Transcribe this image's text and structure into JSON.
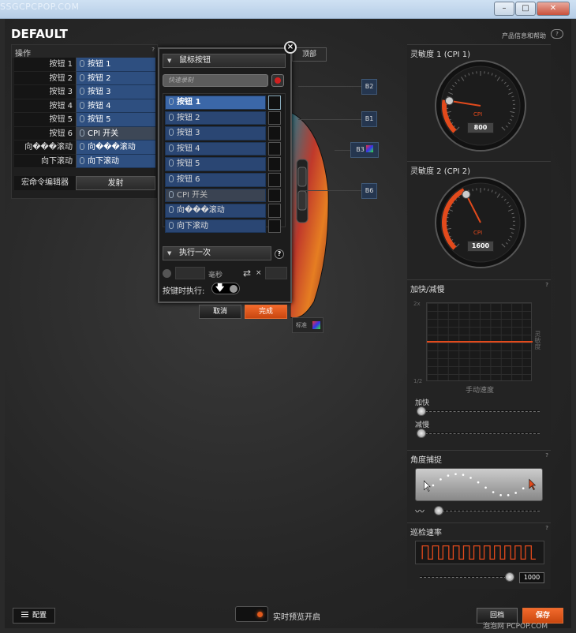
{
  "window": {
    "logo_text": "SSGCPCPOP.COM",
    "min": "–",
    "max": "□",
    "close": "✕"
  },
  "profile": {
    "title": "DEFAULT"
  },
  "help": {
    "link": "产品信息和帮助",
    "icon": "?"
  },
  "actions": {
    "header": "操作",
    "help": "?",
    "rows": [
      {
        "label": "按钮 1",
        "value": "按钮 1"
      },
      {
        "label": "按钮 2",
        "value": "按钮 2"
      },
      {
        "label": "按钮 3",
        "value": "按钮 3"
      },
      {
        "label": "按钮 4",
        "value": "按钮 4"
      },
      {
        "label": "按钮 5",
        "value": "按钮 5"
      },
      {
        "label": "按钮 6",
        "value": "CPI 开关"
      },
      {
        "label": "向���滚动",
        "value": "向���滚动"
      },
      {
        "label": "向下滚动",
        "value": "向下滚动"
      }
    ],
    "macro_label": "宏命令编辑器",
    "macro_value": "发射"
  },
  "popup": {
    "category": "鼠标按钮",
    "record_placeholder": "快速录制",
    "items": [
      {
        "label": "按钮 1",
        "selected": true
      },
      {
        "label": "按钮 2"
      },
      {
        "label": "按钮 3"
      },
      {
        "label": "按钮 4"
      },
      {
        "label": "按钮 5"
      },
      {
        "label": "按钮 6"
      },
      {
        "label": "CPI 开关",
        "cpi": true
      },
      {
        "label": "向���滚动"
      },
      {
        "label": "向下滚动"
      }
    ],
    "exec_mode": "执行一次",
    "exec_help": "?",
    "delay_unit": "毫秒",
    "repeat_x": "×",
    "on_press_label": "按键时执行:",
    "on_press_toggle": "🡇",
    "cancel": "取消",
    "done": "完成"
  },
  "mouse": {
    "all_button": "顶部",
    "callouts": {
      "b2": "B2",
      "b1": "B1",
      "b3": "B3",
      "b6": "B6"
    },
    "standard_label": "标准"
  },
  "cpi1": {
    "title": "灵敏度 1 (CPI 1)",
    "label": "CPI",
    "value": "800",
    "level": 0.2
  },
  "cpi2": {
    "title": "灵敏度 2 (CPI 2)",
    "label": "CPI",
    "value": "1600",
    "level": 0.4
  },
  "accel": {
    "title": "加快/减慢",
    "help": "?",
    "y_top": "2x",
    "y_bottom": "1/2",
    "right_label": "灵敏度",
    "x_label": "手动速度",
    "accel_label": "加快",
    "decel_label": "减慢"
  },
  "angle": {
    "title": "角度捕捉",
    "help": "?",
    "wave": "〰",
    "value_level": 0.05
  },
  "polling": {
    "title": "巡检速率",
    "help": "?",
    "value": "1000"
  },
  "footer": {
    "config": "配置",
    "live_preview": "实时预览开启",
    "revert": "回档",
    "save": "保存"
  },
  "watermark2": "泡泡网 PCPOP.COM",
  "colors": {
    "accent": "#e24a1c",
    "button_blue": "#2e4f80",
    "selected_blue": "#3b67a8"
  }
}
